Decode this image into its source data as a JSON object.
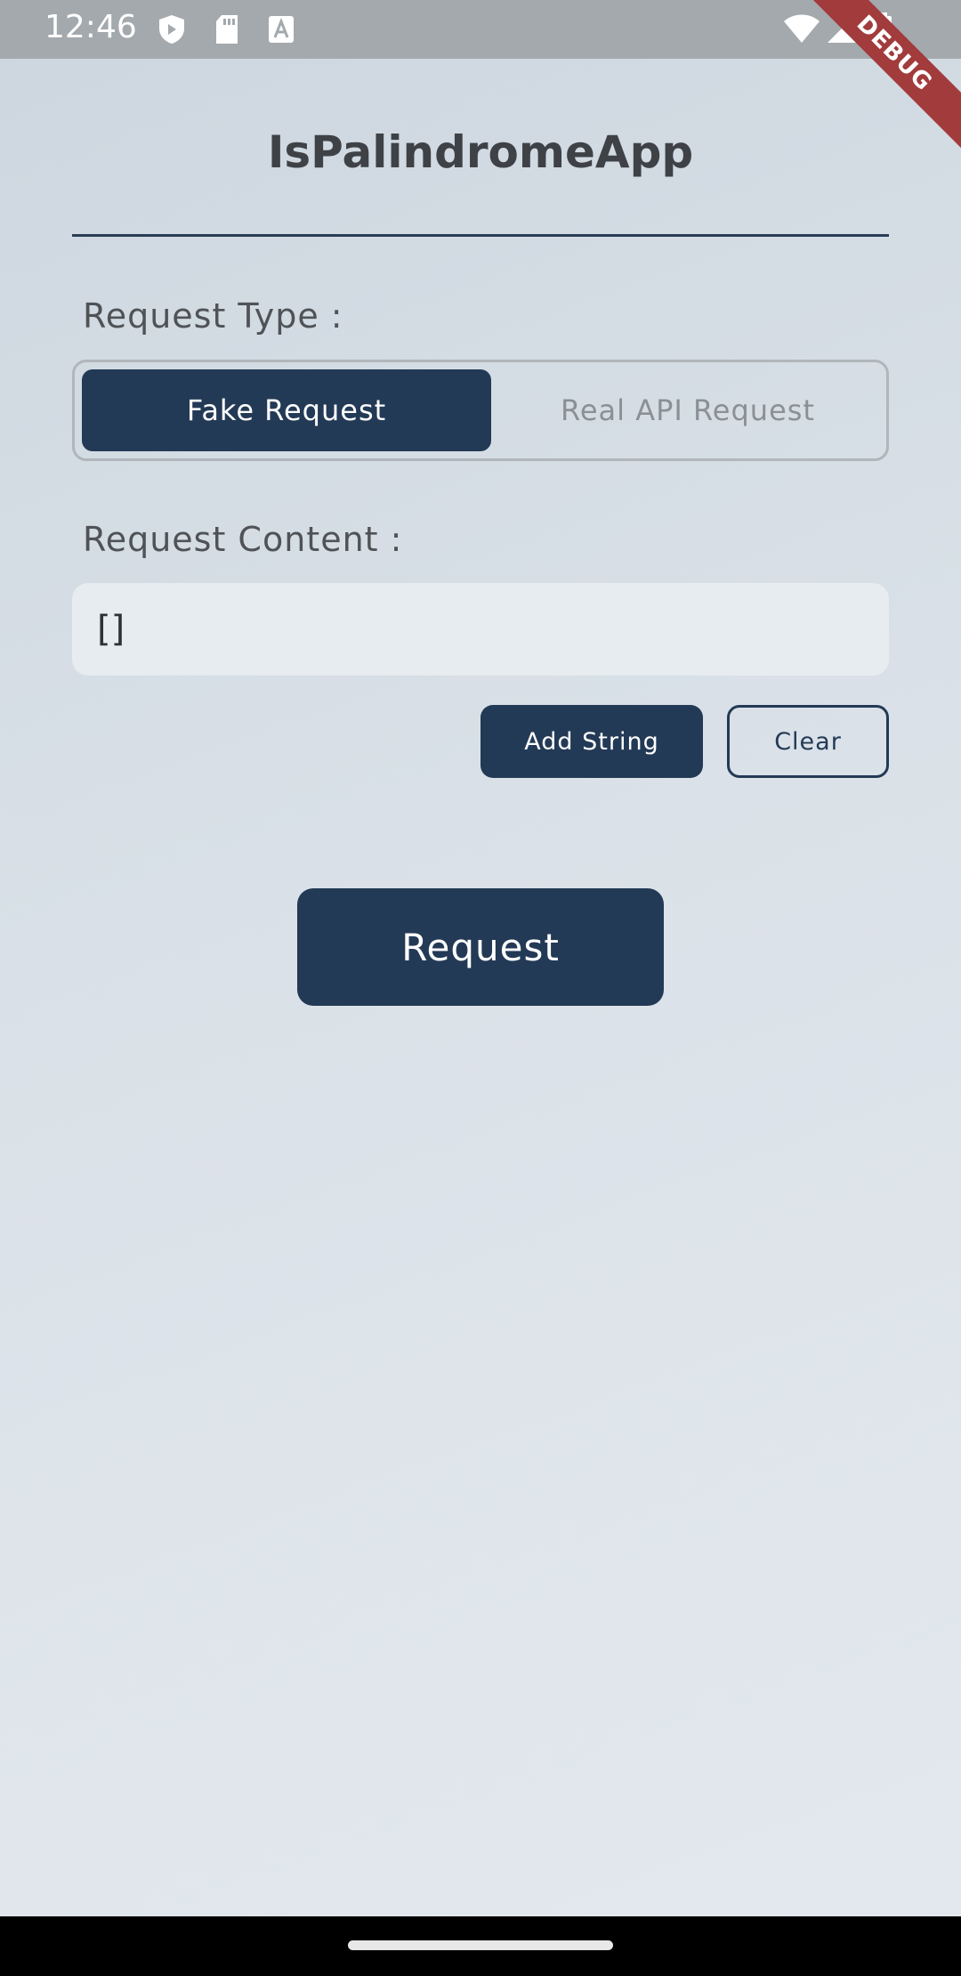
{
  "status_bar": {
    "time": "12:46",
    "left_icons": [
      "shield-icon",
      "sd-card-icon",
      "font-a-icon"
    ],
    "right_icons": [
      "wifi-icon",
      "signal-icon",
      "battery-icon"
    ]
  },
  "debug_banner": "DEBUG",
  "app": {
    "title": "IsPalindromeApp"
  },
  "request_type": {
    "label": "Request Type :",
    "options": [
      "Fake Request",
      "Real API Request"
    ],
    "selected": "Fake Request"
  },
  "request_content": {
    "label": "Request Content :",
    "value": "[]"
  },
  "actions": {
    "add_string": "Add String",
    "clear": "Clear",
    "request": "Request"
  },
  "colors": {
    "primary": "#233a56",
    "background": "#dae1e8",
    "debug_ribbon": "#a23b3c"
  }
}
